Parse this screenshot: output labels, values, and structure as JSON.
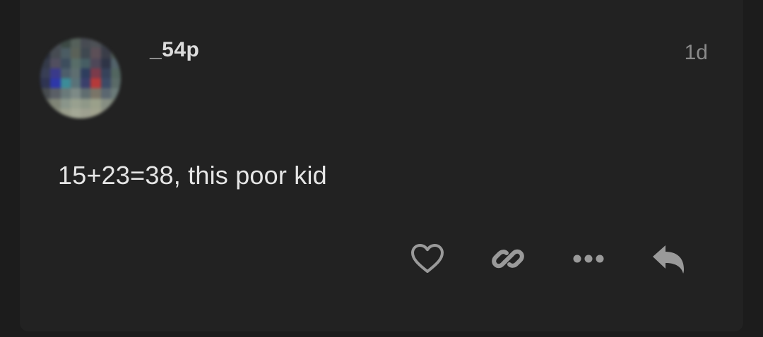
{
  "post": {
    "username": "_54p",
    "timestamp": "1d",
    "body": "15+23=38, this poor kid"
  },
  "avatar": {
    "colors": [
      "#3a3d44",
      "#4a4f56",
      "#3d4a45",
      "#55605a",
      "#474b52",
      "#4e5156",
      "#3b4049",
      "#545860",
      "#2a2f3d",
      "#464b52",
      "#4b5c63",
      "#5a6158",
      "#3f4850",
      "#5c4f57",
      "#3a3d48",
      "#4e5a55",
      "#343a49",
      "#514e5f",
      "#3d4d5d",
      "#586d68",
      "#465d63",
      "#4e4758",
      "#2e3446",
      "#53636a",
      "#383e55",
      "#3a3a8a",
      "#4d5e6b",
      "#5e6e70",
      "#2e3d5e",
      "#7b3b4b",
      "#36425a",
      "#52655f",
      "#2f3452",
      "#2e37a8",
      "#3c8c98",
      "#5a7278",
      "#3a3f6b",
      "#b53a3a",
      "#3c4a66",
      "#5a6a67",
      "#484c4f",
      "#5a5f66",
      "#6a7a7a",
      "#7d8a86",
      "#606d70",
      "#7a7568",
      "#5b6770",
      "#6b7a78",
      "#6c7068",
      "#7f8476",
      "#8a958a",
      "#98a08f",
      "#8f9888",
      "#9aa08a",
      "#868e82",
      "#7d8578",
      "#7a7d70",
      "#8a8e80",
      "#9a9e8c",
      "#a4a896",
      "#9ea090",
      "#a0a28e",
      "#8e9284",
      "#868a7e"
    ]
  },
  "actions": {
    "like_icon": "heart-icon",
    "link_icon": "link-icon",
    "more_icon": "ellipsis-icon",
    "reply_icon": "reply-icon",
    "icon_color": "#9a9a9a"
  }
}
